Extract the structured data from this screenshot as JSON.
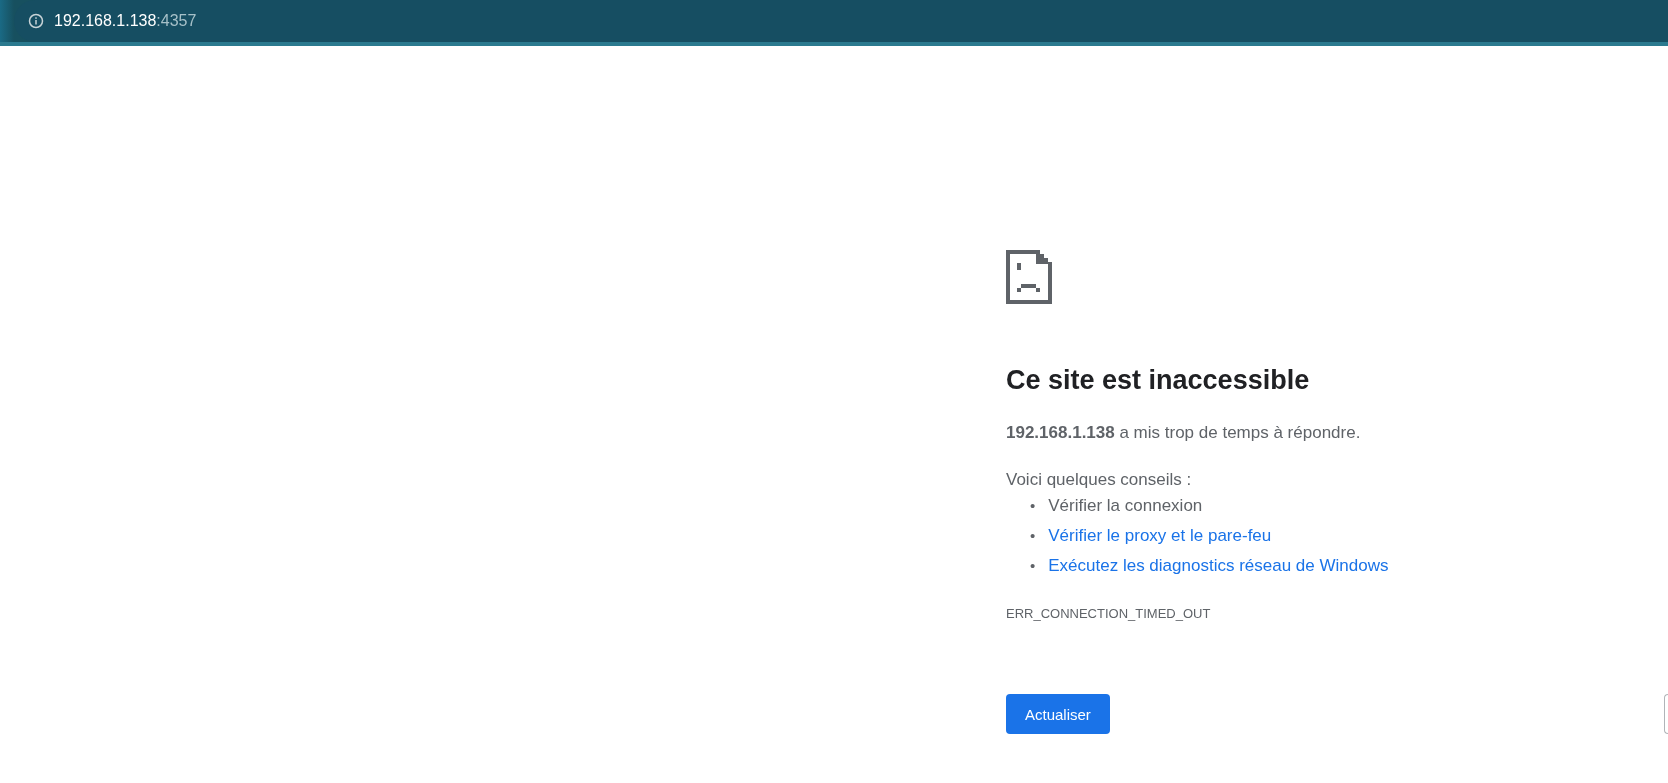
{
  "address_bar": {
    "host": "192.168.1.138",
    "port": ":4357"
  },
  "error": {
    "title": "Ce site est inaccessible",
    "message": "**192.168.1.138** a mis trop de temps à répondre.",
    "tips_heading": "Voici quelques conseils :",
    "tips": [
      {
        "bullet": "•",
        "text": "Vérifier la connexion",
        "kind": "text"
      },
      {
        "bullet": "•",
        "text": "Vérifier le proxy et le pare-feu",
        "kind": "link"
      },
      {
        "bullet": "•",
        "text": "Exécutez les diagnostics réseau de Windows",
        "kind": "link"
      }
    ],
    "code": "ERR_CONNECTION_TIMED_OUT"
  },
  "buttons": [
    {
      "label": "Actualiser",
      "kind": "primary"
    },
    {
      "kind": "outline"
    }
  ]
}
